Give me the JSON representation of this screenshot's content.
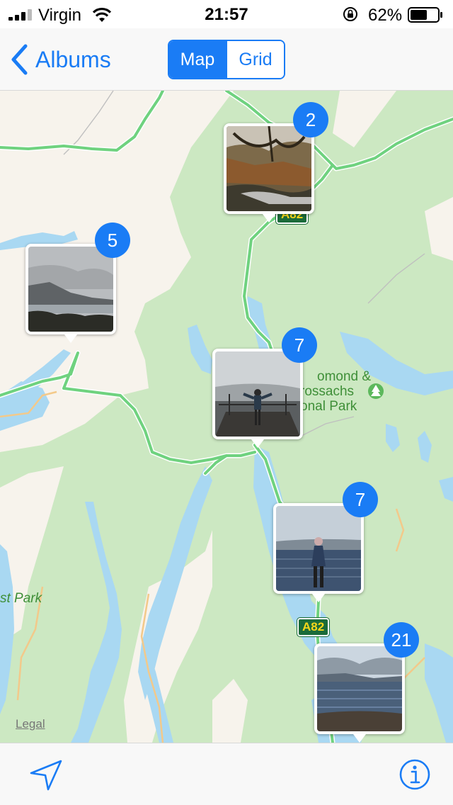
{
  "status_bar": {
    "carrier": "Virgin",
    "time": "21:57",
    "battery_percent": "62%",
    "battery_level": 0.62,
    "icons": [
      "signal-icon",
      "wifi-icon",
      "orientation-lock-icon",
      "battery-icon"
    ]
  },
  "nav": {
    "back_label": "Albums",
    "segments": [
      "Map",
      "Grid"
    ],
    "selected_segment": "Map"
  },
  "map": {
    "place_labels": [
      {
        "text": "omond &"
      },
      {
        "text": "rossachs"
      },
      {
        "text": "onal Park"
      },
      {
        "text": "st Park"
      }
    ],
    "road_signs": [
      "A82",
      "A82"
    ],
    "legal_label": "Legal",
    "photo_clusters": [
      {
        "count": "2",
        "scene": "forest-stream"
      },
      {
        "count": "5",
        "scene": "loch-mist"
      },
      {
        "count": "7",
        "scene": "pier-person"
      },
      {
        "count": "7",
        "scene": "loch-person"
      },
      {
        "count": "21",
        "scene": "loch-beach"
      }
    ]
  },
  "toolbar": {
    "location_icon": "location-arrow-icon",
    "info_icon": "info-icon"
  },
  "colors": {
    "accent": "#1a7cf5",
    "park_green": "#cce8c2",
    "land": "#f7f3ec",
    "water": "#a9d8f2",
    "major_road": "#6fd27f",
    "minor_road": "#f3c98a"
  }
}
